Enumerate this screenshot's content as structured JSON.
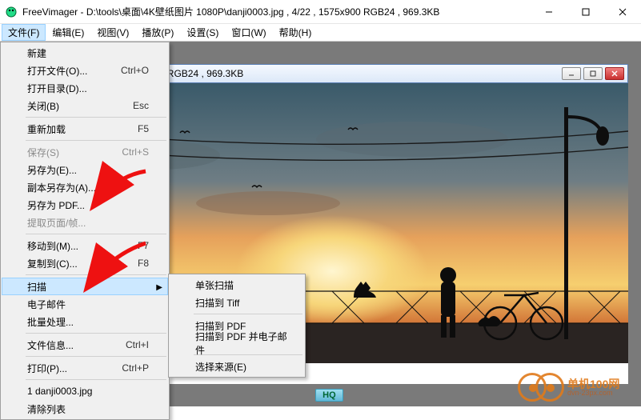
{
  "titlebar": {
    "app_name": "FreeVimager",
    "title_sep": " - ",
    "path": "D:\\tools\\桌面\\4K壁纸图片 1080P\\danji0003.jpg , 4/22 , 1575x900 RGB24 , 969.3KB"
  },
  "menubar": {
    "items": [
      {
        "label": "文件(F)",
        "open": true
      },
      {
        "label": "编辑(E)"
      },
      {
        "label": "视图(V)"
      },
      {
        "label": "播放(P)"
      },
      {
        "label": "设置(S)"
      },
      {
        "label": "窗口(W)"
      },
      {
        "label": "帮助(H)"
      }
    ]
  },
  "file_menu": {
    "items": [
      {
        "label": "新建"
      },
      {
        "label": "打开文件(O)...",
        "shortcut": "Ctrl+O"
      },
      {
        "label": "打开目录(D)..."
      },
      {
        "label": "关闭(B)",
        "shortcut": "Esc"
      },
      {
        "sep": true
      },
      {
        "label": "重新加载",
        "shortcut": "F5"
      },
      {
        "sep": true
      },
      {
        "label": "保存(S)",
        "shortcut": "Ctrl+S",
        "disabled": true
      },
      {
        "label": "另存为(E)..."
      },
      {
        "label": "副本另存为(A)..."
      },
      {
        "label": "另存为 PDF..."
      },
      {
        "label": "提取页面/帧...",
        "disabled": true
      },
      {
        "sep": true
      },
      {
        "label": "移动到(M)...",
        "shortcut": "F7"
      },
      {
        "label": "复制到(C)...",
        "shortcut": "F8"
      },
      {
        "sep": true
      },
      {
        "label": "扫描",
        "submenu": true,
        "highlight": true
      },
      {
        "label": "电子邮件"
      },
      {
        "label": "批量处理..."
      },
      {
        "sep": true
      },
      {
        "label": "文件信息...",
        "shortcut": "Ctrl+I"
      },
      {
        "sep": true
      },
      {
        "label": "打印(P)...",
        "shortcut": "Ctrl+P"
      },
      {
        "sep": true
      },
      {
        "label": "1 danji0003.jpg"
      },
      {
        "label": "清除列表"
      }
    ]
  },
  "scan_submenu": {
    "items": [
      {
        "label": "单张扫描"
      },
      {
        "label": "扫描到 Tiff"
      },
      {
        "sep": true
      },
      {
        "label": "扫描到 PDF"
      },
      {
        "label": "扫描到 PDF 并电子邮件"
      },
      {
        "sep": true
      },
      {
        "label": "选择来源(E)"
      }
    ]
  },
  "child_window": {
    "title": "danji0003.jpg , 4/22 , 1575x900 RGB24 , 969.3KB"
  },
  "toolbar": {
    "hq_label": "HQ"
  },
  "watermark": {
    "big": "单机100网",
    "small": "dvn-23px.com"
  }
}
